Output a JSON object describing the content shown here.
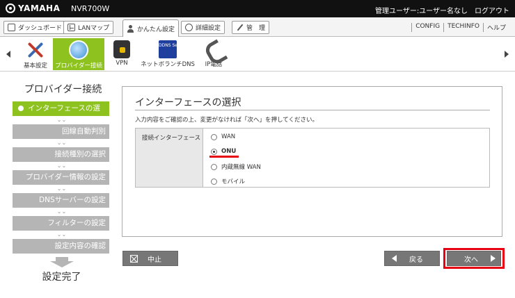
{
  "header": {
    "brand": "YAMAHA",
    "model": "NVR700W",
    "user": "管理ユーザー:ユーザー名なし",
    "logout": "ログアウト"
  },
  "tabs": [
    {
      "label": "ダッシュボード",
      "icon": "dashboard-icon"
    },
    {
      "label": "LANマップ",
      "icon": "lan-map-icon"
    },
    {
      "label": "かんたん設定",
      "icon": "easy-setup-icon",
      "active": true
    },
    {
      "label": "詳細設定",
      "icon": "gear-icon"
    },
    {
      "label": "管　理",
      "icon": "wrench-icon"
    }
  ],
  "tab_links": [
    "CONFIG",
    "TECHINFO",
    "ヘルプ"
  ],
  "ribbon": [
    {
      "label": "基本設定",
      "icon": "tools-icon"
    },
    {
      "label": "プロバイダー接続",
      "icon": "globe-icon",
      "active": true
    },
    {
      "label": "VPN",
      "icon": "vpn-icon"
    },
    {
      "label": "ネットボランチDNS",
      "icon": "ddns-icon",
      "icon_text": "DDNS Service"
    },
    {
      "label": "IP電話",
      "icon": "phone-icon"
    }
  ],
  "sidebar": {
    "title": "プロバイダー接続",
    "steps": [
      "インターフェースの選択",
      "回線自動判別",
      "接続種別の選択",
      "プロバイダー情報の設定",
      "DNSサーバーの設定",
      "フィルターの設定",
      "設定内容の確認"
    ],
    "done": "設定完了"
  },
  "panel": {
    "title": "インターフェースの選択",
    "instruction": "入力内容をご確認の上、変更がなければ「次へ」を押してください。",
    "field_label": "接続インターフェース",
    "options": [
      "WAN",
      "ONU",
      "内蔵無線 WAN",
      "モバイル"
    ],
    "selected": "ONU"
  },
  "buttons": {
    "cancel": "中止",
    "back": "戻る",
    "next": "次へ"
  },
  "colors": {
    "accent_green": "#8dc21f",
    "highlight_red": "#e60012",
    "header_bg": "#111111"
  }
}
